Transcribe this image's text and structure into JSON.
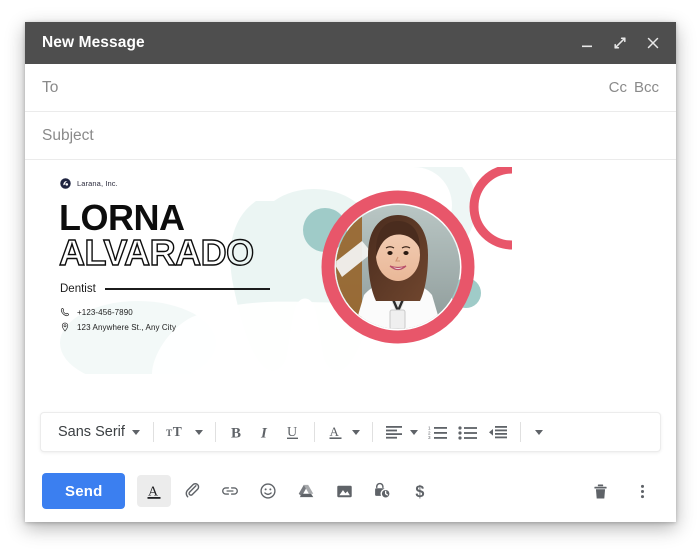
{
  "window": {
    "title": "New Message",
    "controls": [
      {
        "name": "minimize",
        "icon": "minimize-icon"
      },
      {
        "name": "expand",
        "icon": "expand-icon"
      },
      {
        "name": "close",
        "icon": "close-icon"
      }
    ]
  },
  "fields": {
    "to": {
      "placeholder": "To",
      "value": ""
    },
    "cc": "Cc",
    "bcc": "Bcc",
    "subject": {
      "placeholder": "Subject",
      "value": ""
    }
  },
  "business_card": {
    "brand": "Larana, Inc.",
    "first_name": "LORNA",
    "last_name": "ALVARADO",
    "role": "Dentist",
    "phone": "+123-456-7890",
    "address": "123 Anywhere St., Any City",
    "colors": {
      "ring": "#e8566a",
      "accent_teal": "#9fcbc8",
      "watermark": "#eaf4f2",
      "text": "#0d0d0d"
    }
  },
  "format_toolbar": {
    "font_family": "Sans Serif",
    "items": [
      {
        "name": "font-family-dropdown",
        "label": "Sans Serif",
        "icon": "chevron-down-icon"
      },
      {
        "name": "font-size-dropdown",
        "label": "",
        "icon": "font-size-icon"
      },
      {
        "name": "bold-button",
        "label": "B",
        "icon": "bold-icon"
      },
      {
        "name": "italic-button",
        "label": "I",
        "icon": "italic-icon"
      },
      {
        "name": "underline-button",
        "label": "U",
        "icon": "underline-icon"
      },
      {
        "name": "text-color-button",
        "label": "A",
        "icon": "text-color-icon"
      },
      {
        "name": "align-button",
        "label": "",
        "icon": "align-icon"
      },
      {
        "name": "numbered-list-button",
        "label": "",
        "icon": "numbered-list-icon"
      },
      {
        "name": "bulleted-list-button",
        "label": "",
        "icon": "bulleted-list-icon"
      },
      {
        "name": "indent-button",
        "label": "",
        "icon": "indent-icon"
      },
      {
        "name": "more-format-button",
        "label": "",
        "icon": "chevron-down-icon"
      }
    ]
  },
  "action_bar": {
    "send_label": "Send",
    "send_color": "#3b7ff0",
    "icons": [
      {
        "name": "formatting-options-button",
        "icon": "text-format-icon",
        "active": true
      },
      {
        "name": "attach-file-button",
        "icon": "paperclip-icon",
        "active": false
      },
      {
        "name": "insert-link-button",
        "icon": "link-icon",
        "active": false
      },
      {
        "name": "insert-emoji-button",
        "icon": "emoji-icon",
        "active": false
      },
      {
        "name": "insert-drive-file-button",
        "icon": "google-drive-icon",
        "active": false
      },
      {
        "name": "insert-photo-button",
        "icon": "photo-icon",
        "active": false
      },
      {
        "name": "confidential-mode-button",
        "icon": "lock-clock-icon",
        "active": false
      },
      {
        "name": "insert-money-button",
        "icon": "dollar-icon",
        "active": false
      }
    ],
    "right_icons": [
      {
        "name": "discard-draft-button",
        "icon": "trash-icon"
      },
      {
        "name": "more-options-button",
        "icon": "more-vertical-icon"
      }
    ]
  }
}
